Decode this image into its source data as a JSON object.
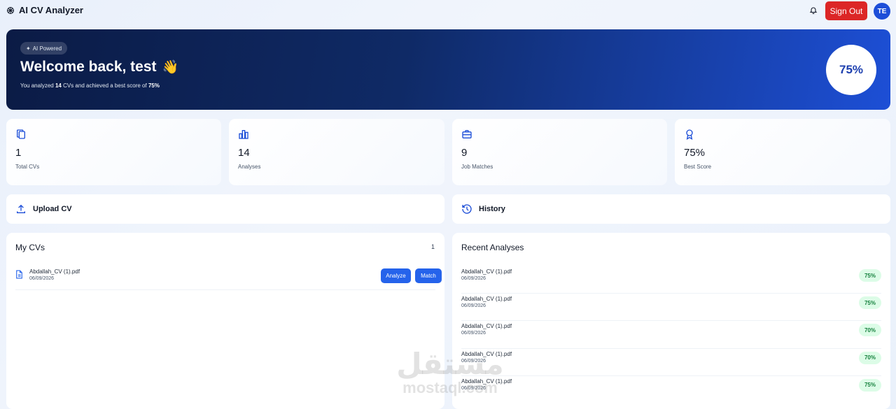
{
  "app": {
    "title": "AI CV Analyzer",
    "sign_out_label": "Sign Out",
    "avatar_initials": "TE"
  },
  "colors": {
    "primary": "#2563eb",
    "danger": "#dc2626",
    "hero_start": "#0b1b45",
    "hero_end": "#1d4fd6",
    "success_bg": "#dcfce7",
    "success_text": "#15803d"
  },
  "hero": {
    "badge": "AI Powered",
    "title": "Welcome back, test",
    "wave_emoji": "👋",
    "subtitle_prefix": "You analyzed ",
    "subtitle_count": "14",
    "subtitle_middle": " CVs and achieved a best score of ",
    "subtitle_score": "75%",
    "score": "75%"
  },
  "stats": [
    {
      "icon": "files-icon",
      "value": "1",
      "label": "Total CVs"
    },
    {
      "icon": "bar-chart-icon",
      "value": "14",
      "label": "Analyses"
    },
    {
      "icon": "briefcase-icon",
      "value": "9",
      "label": "Job Matches"
    },
    {
      "icon": "award-icon",
      "value": "75%",
      "label": "Best Score"
    }
  ],
  "actions": {
    "upload_label": "Upload CV",
    "history_label": "History"
  },
  "my_cvs": {
    "title": "My CVs",
    "count": "1",
    "items": [
      {
        "name": "Abdallah_CV (1).pdf",
        "date": "06/09/2026",
        "analyze_label": "Analyze",
        "match_label": "Match"
      }
    ]
  },
  "recent_analyses": {
    "title": "Recent Analyses",
    "items": [
      {
        "name": "Abdallah_CV (1).pdf",
        "date": "06/09/2026",
        "score": "75%"
      },
      {
        "name": "Abdallah_CV (1).pdf",
        "date": "06/09/2026",
        "score": "75%"
      },
      {
        "name": "Abdallah_CV (1).pdf",
        "date": "06/09/2026",
        "score": "70%"
      },
      {
        "name": "Abdallah_CV (1).pdf",
        "date": "06/09/2026",
        "score": "70%"
      },
      {
        "name": "Abdallah_CV (1).pdf",
        "date": "06/09/2026",
        "score": "75%"
      }
    ]
  },
  "watermark": {
    "arabic": "مستقل",
    "latin": "mostaql.com"
  }
}
